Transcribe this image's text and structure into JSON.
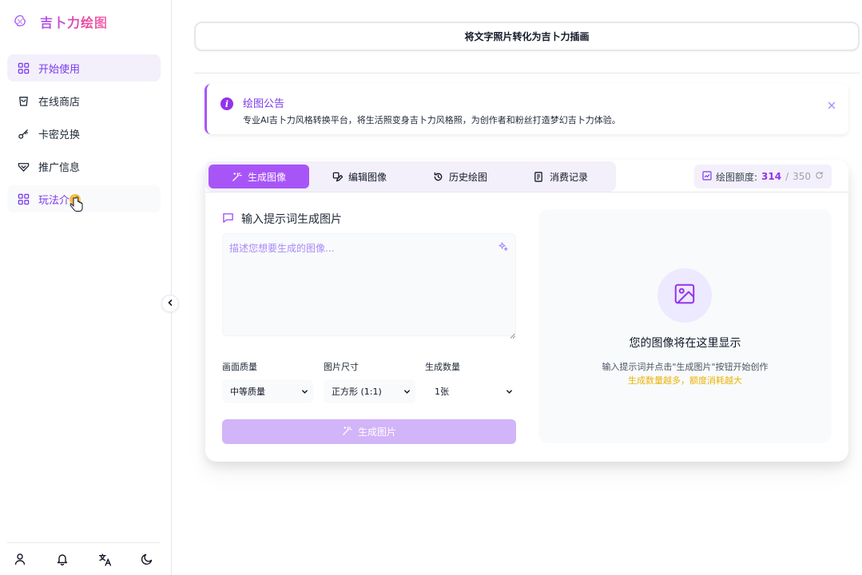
{
  "app": {
    "name": "吉卜力绘图",
    "colors": {
      "accent": "#a855f7",
      "accent_dark": "#7c3aed",
      "warning": "#eab308"
    }
  },
  "sidebar": {
    "items": [
      {
        "label": "开始使用",
        "icon": "grid-icon",
        "state": "active"
      },
      {
        "label": "在线商店",
        "icon": "shopping-bag-icon",
        "state": "normal"
      },
      {
        "label": "卡密兑换",
        "icon": "key-icon",
        "state": "normal"
      },
      {
        "label": "推广信息",
        "icon": "handshake-icon",
        "state": "normal"
      },
      {
        "label": "玩法介绍",
        "icon": "grid-icon",
        "state": "hover"
      }
    ],
    "footer_icons": [
      "user-icon",
      "bell-icon",
      "language-icon",
      "moon-icon"
    ]
  },
  "top_button": {
    "label": "将文字照片转化为吉卜力插画"
  },
  "notice": {
    "title": "绘图公告",
    "text": "专业AI吉卜力风格转换平台，将生活照变身吉卜力风格照，为创作者和粉丝打造梦幻吉卜力体验。"
  },
  "tabs": [
    {
      "label": "生成图像",
      "icon": "magic-wand-icon",
      "active": true
    },
    {
      "label": "编辑图像",
      "icon": "edit-image-icon",
      "active": false
    },
    {
      "label": "历史绘图",
      "icon": "history-icon",
      "active": false
    },
    {
      "label": "消费记录",
      "icon": "receipt-icon",
      "active": false
    }
  ],
  "quota": {
    "label": "绘图额度:",
    "used": "314",
    "separator": "/",
    "total": "350"
  },
  "prompt": {
    "label": "输入提示词生成图片",
    "placeholder": "描述您想要生成的图像...",
    "value": ""
  },
  "options": {
    "quality": {
      "label": "画面质量",
      "value": "中等质量"
    },
    "size": {
      "label": "图片尺寸",
      "value": "正方形 (1:1)"
    },
    "count": {
      "label": "生成数量",
      "value": "1张"
    }
  },
  "generate_button": {
    "label": "生成图片"
  },
  "preview": {
    "title": "您的图像将在这里显示",
    "hint": "输入提示词并点击\"生成图片\"按钮开始创作",
    "warning": "生成数量越多，额度消耗越大"
  }
}
